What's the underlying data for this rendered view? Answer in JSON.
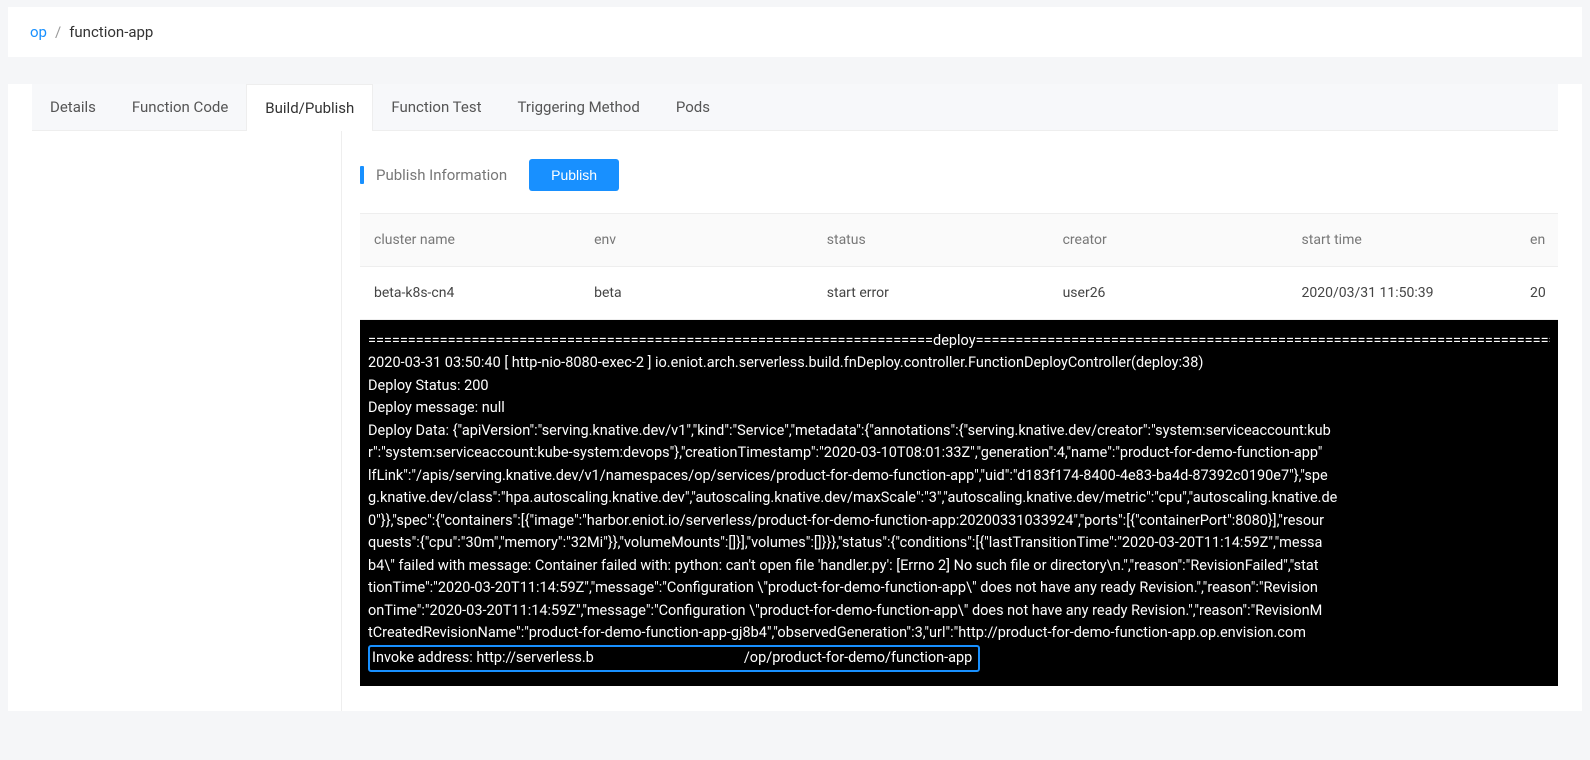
{
  "breadcrumb": {
    "parent": "op",
    "sep": "/",
    "current": "function-app"
  },
  "tabs": {
    "details": "Details",
    "function_code": "Function Code",
    "build_publish": "Build/Publish",
    "function_test": "Function Test",
    "triggering_method": "Triggering Method",
    "pods": "Pods"
  },
  "section": {
    "title": "Publish Information",
    "publish_btn": "Publish"
  },
  "table": {
    "headers": {
      "cluster": "cluster name",
      "env": "env",
      "status": "status",
      "creator": "creator",
      "start": "start time",
      "end": "en"
    },
    "row": {
      "cluster": "beta-k8s-cn4",
      "env": "beta",
      "status": "start error",
      "creator": "user26",
      "start": "2020/03/31 11:50:39",
      "end": "20"
    }
  },
  "console": {
    "l1": "=======================================================================deploy==========================================================================",
    "l2": "2020-03-31 03:50:40 [ http-nio-8080-exec-2 ] io.eniot.arch.serverless.build.fnDeploy.controller.FunctionDeployController(deploy:38)",
    "l3": "Deploy Status: 200",
    "l4": "Deploy message: null",
    "l5": "Deploy Data: {\"apiVersion\":\"serving.knative.dev/v1\",\"kind\":\"Service\",\"metadata\":{\"annotations\":{\"serving.knative.dev/creator\":\"system:serviceaccount:kub",
    "l6": "r\":\"system:serviceaccount:kube-system:devops\"},\"creationTimestamp\":\"2020-03-10T08:01:33Z\",\"generation\":4,\"name\":\"product-for-demo-function-app\"",
    "l7": "lfLink\":\"/apis/serving.knative.dev/v1/namespaces/op/services/product-for-demo-function-app\",\"uid\":\"d183f174-8400-4e83-ba4d-87392c0190e7\"},\"spe",
    "l8": "g.knative.dev/class\":\"hpa.autoscaling.knative.dev\",\"autoscaling.knative.dev/maxScale\":\"3\",\"autoscaling.knative.dev/metric\":\"cpu\",\"autoscaling.knative.de",
    "l9": "0\"}},\"spec\":{\"containers\":[{\"image\":\"harbor.eniot.io/serverless/product-for-demo-function-app:20200331033924\",\"ports\":[{\"containerPort\":8080}],\"resour",
    "l10": "quests\":{\"cpu\":\"30m\",\"memory\":\"32Mi\"}},\"volumeMounts\":[]}],\"volumes\":[]}}},\"status\":{\"conditions\":[{\"lastTransitionTime\":\"2020-03-20T11:14:59Z\",\"messa",
    "l11": "b4\\\" failed with message: Container failed with: python: can't open file 'handler.py': [Errno 2] No such file or directory\\n.\",\"reason\":\"RevisionFailed\",\"stat",
    "l12": "tionTime\":\"2020-03-20T11:14:59Z\",\"message\":\"Configuration \\\"product-for-demo-function-app\\\" does not have any ready Revision.\",\"reason\":\"Revision",
    "l13": "onTime\":\"2020-03-20T11:14:59Z\",\"message\":\"Configuration \\\"product-for-demo-function-app\\\" does not have any ready Revision.\",\"reason\":\"RevisionM",
    "l14": "tCreatedRevisionName\":\"product-for-demo-function-app-gj8b4\",\"observedGeneration\":3,\"url\":\"http://product-for-demo-function-app.op.envision.com",
    "invoke_pre": "Invoke address: http://serverless.b",
    "invoke_post": "/op/product-for-demo/function-app"
  }
}
